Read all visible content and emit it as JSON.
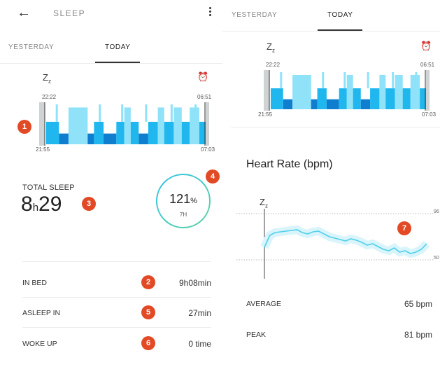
{
  "left": {
    "app_bar": {
      "title": "SLEEP",
      "back_icon": "arrow-left-icon",
      "menu_icon": "more-vertical-icon"
    },
    "tabs": [
      {
        "label": "YESTERDAY",
        "active": false
      },
      {
        "label": "TODAY",
        "active": true
      }
    ],
    "sleep_chart": {
      "start_icon": "zzz-icon",
      "end_icon": "alarm-clock-icon",
      "fell_asleep": "22:22",
      "woke": "06:51",
      "in_bed_start": "21:55",
      "in_bed_end": "07:03"
    },
    "total_sleep": {
      "label": "TOTAL SLEEP",
      "hours": "8",
      "h_unit": "h",
      "minutes": "29"
    },
    "goal": {
      "percent": "121",
      "percent_sign": "%",
      "target": "7H",
      "fraction": 1.21
    },
    "stats": [
      {
        "label": "IN BED",
        "value": "9h08min"
      },
      {
        "label": "ASLEEP IN",
        "value": "27min"
      },
      {
        "label": "WOKE UP",
        "value": "0 time"
      }
    ]
  },
  "right": {
    "tabs": [
      {
        "label": "YESTERDAY",
        "active": false
      },
      {
        "label": "TODAY",
        "active": true
      }
    ],
    "sleep_chart": {
      "start_icon": "zzz-icon",
      "end_icon": "alarm-clock-icon",
      "fell_asleep": "22:22",
      "woke": "06:51",
      "in_bed_start": "21:55",
      "in_bed_end": "07:03"
    },
    "heart_rate": {
      "title": "Heart Rate (bpm)",
      "y_max_label": "96",
      "y_min_label": "50",
      "marker_icon": "zzz-icon",
      "average_label": "AVERAGE",
      "average_value": "65 bpm",
      "peak_label": "PEAK",
      "peak_value": "81 bpm"
    }
  },
  "annotations": [
    "1",
    "2",
    "3",
    "4",
    "5",
    "6",
    "7"
  ],
  "colors": {
    "light_sleep": "#8fe2f8",
    "medium_sleep": "#1fb7ee",
    "deep_sleep": "#0f7ecf",
    "awake": "#cfd3d3",
    "ring_start": "#33c3e6",
    "ring_end": "#5fd3a3",
    "heart_line": "#4fd0ea",
    "badge": "#e24a26"
  }
}
